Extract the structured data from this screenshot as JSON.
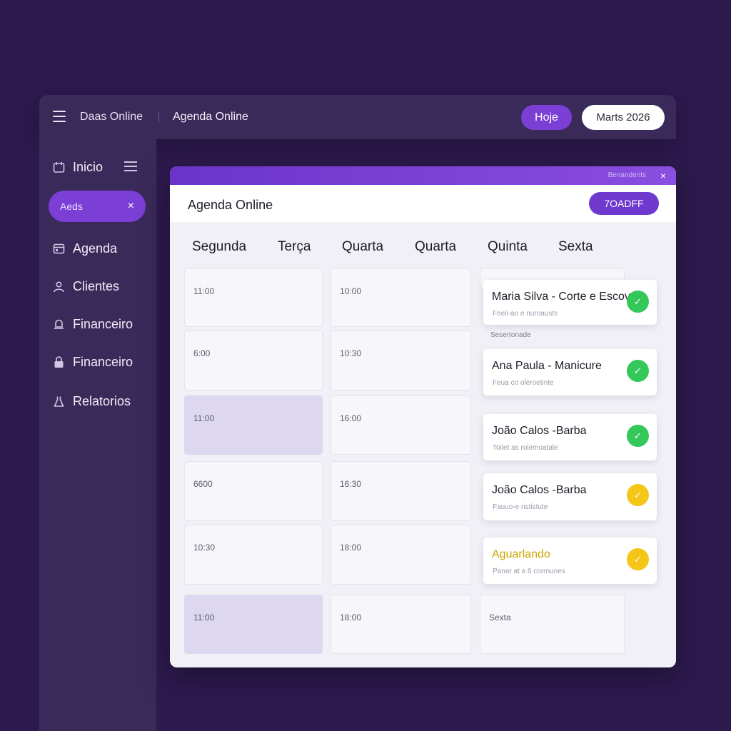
{
  "topbar": {
    "app_name": "Daas Online",
    "page_name": "Agenda Online",
    "today_label": "Hoje",
    "month_label": "Marts 2026"
  },
  "sidebar": {
    "inicio": "Inicio",
    "chip_label": "Aeds",
    "chip_close": "×",
    "items": [
      {
        "label": "Agenda",
        "icon": "calendar-icon"
      },
      {
        "label": "Clientes",
        "icon": "person-icon"
      },
      {
        "label": "Financeiro",
        "icon": "bell-icon"
      },
      {
        "label": "Financeiro",
        "icon": "lock-icon"
      },
      {
        "label": "Relatorios",
        "icon": "flask-icon"
      }
    ]
  },
  "card": {
    "band_text": "Benandents",
    "band_close": "×",
    "title": "Agenda Online",
    "action_label": "7OADFF",
    "days": [
      "Segunda",
      "Terça",
      "Quarta",
      "Quarta",
      "Quinta",
      "Sexta"
    ],
    "col1_times": [
      "11:00",
      "6:00",
      "11:00",
      "6600",
      "10:30",
      "11:00"
    ],
    "col2_times": [
      "10:00",
      "10:30",
      "16:00",
      "16:30",
      "18:00",
      "18:00"
    ],
    "col3_bottom": "Sexta",
    "separator_label": "Sesertonade",
    "appointments": [
      {
        "name": "Maria Silva - Corte e Escova",
        "sub": "Feeli-ao e nuroausts",
        "status": "green"
      },
      {
        "name": "Ana Paula - Manicure",
        "sub": "Feua co oleroetinte",
        "status": "green"
      },
      {
        "name": "João Calos -Barba",
        "sub": "Toilet as rolemoatale",
        "status": "green"
      },
      {
        "name": "João Calos -Barba",
        "sub": "Fauuo-e rististute",
        "status": "yellow"
      },
      {
        "name": "Aguarlando",
        "sub": "Panar at a 6 corrnunes",
        "status": "yellow"
      }
    ]
  },
  "colors": {
    "background": "#2d1a4e",
    "accent": "#7b3fd6",
    "confirmed": "#34c759",
    "pending": "#f5c518"
  }
}
